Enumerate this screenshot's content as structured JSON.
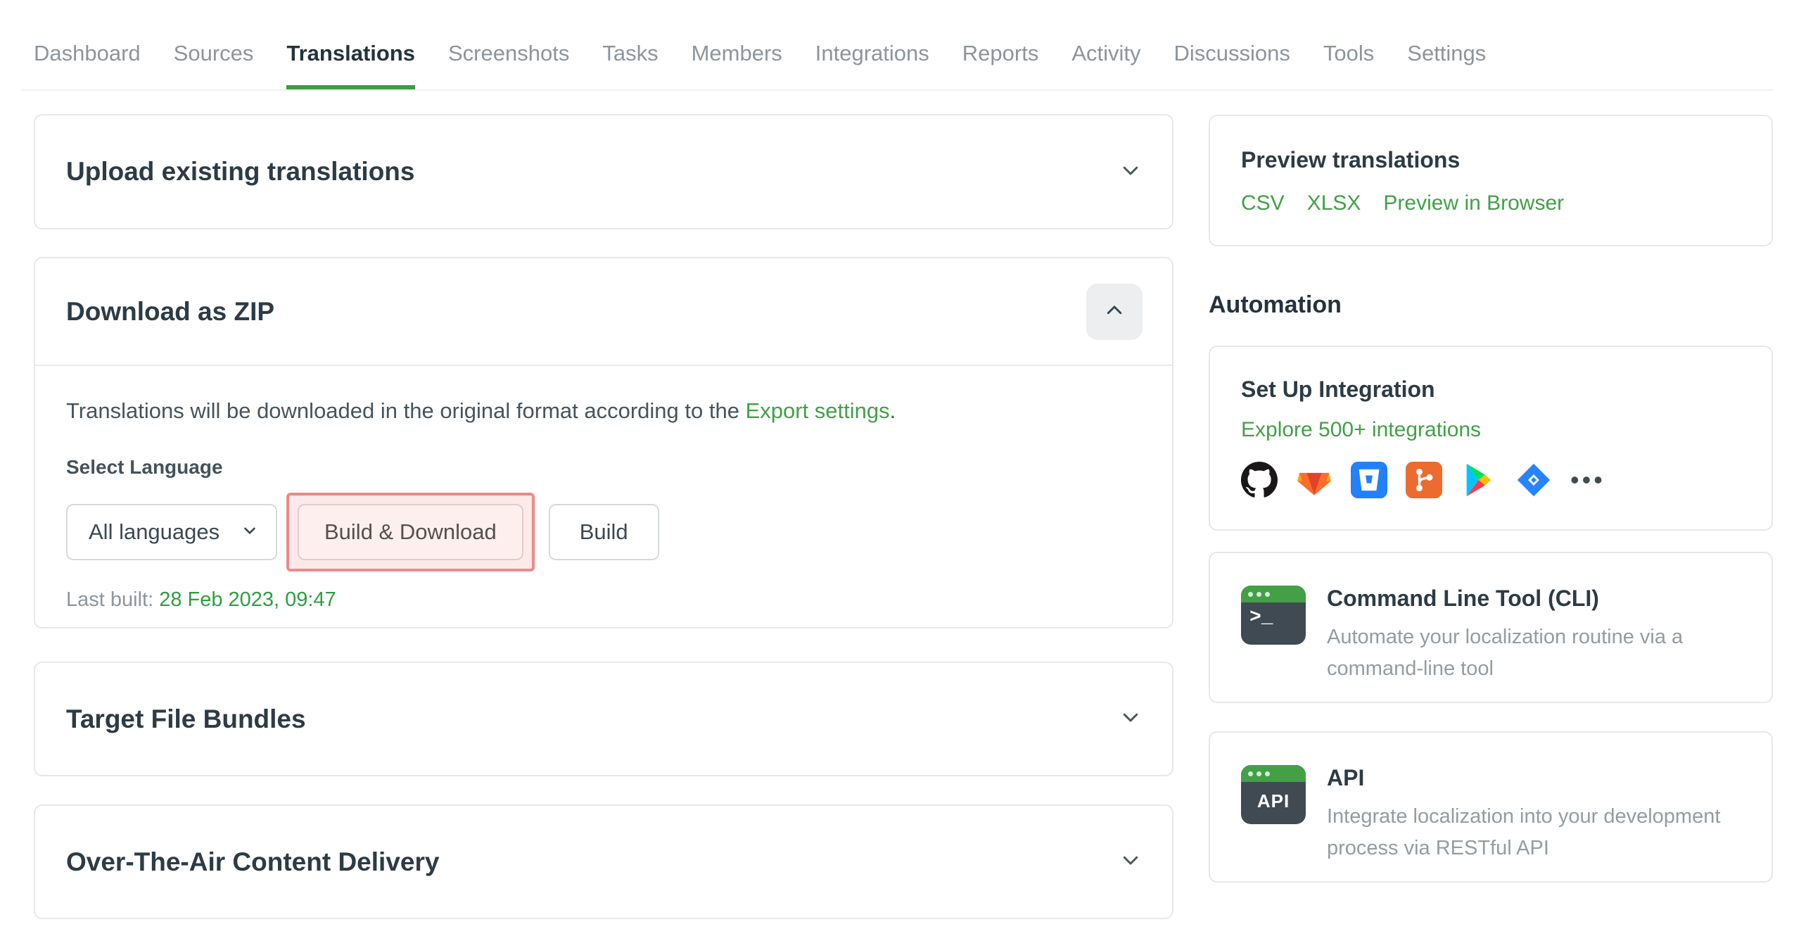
{
  "nav": {
    "tabs": [
      "Dashboard",
      "Sources",
      "Translations",
      "Screenshots",
      "Tasks",
      "Members",
      "Integrations",
      "Reports",
      "Activity",
      "Discussions",
      "Tools",
      "Settings"
    ],
    "active_tab": "Translations"
  },
  "main": {
    "upload_panel": {
      "title": "Upload existing translations"
    },
    "download_panel": {
      "title": "Download as ZIP",
      "description_prefix": "Translations will be downloaded in the original format according to the ",
      "description_link": "Export settings",
      "description_suffix": ".",
      "select_language_label": "Select Language",
      "language_select_value": "All languages",
      "build_download_label": "Build & Download",
      "build_label": "Build",
      "last_built_label": "Last built:",
      "last_built_value": "28 Feb 2023, 09:47"
    },
    "bundles_panel": {
      "title": "Target File Bundles"
    },
    "ota_panel": {
      "title": "Over-The-Air Content Delivery"
    }
  },
  "sidebar": {
    "preview": {
      "title": "Preview translations",
      "links": [
        "CSV",
        "XLSX",
        "Preview in Browser"
      ]
    },
    "automation_heading": "Automation",
    "integration": {
      "title": "Set Up Integration",
      "link": "Explore 500+ integrations",
      "icons": [
        "github",
        "gitlab",
        "bitbucket",
        "git",
        "google-play",
        "jira",
        "more"
      ],
      "more_glyph": "•••"
    },
    "cli": {
      "title": "Command Line Tool (CLI)",
      "description": "Automate your localization routine via a command-line tool",
      "icon_text": ">_"
    },
    "api": {
      "title": "API",
      "description": "Integrate localization into your development process via RESTful API",
      "icon_text": "API"
    }
  },
  "colors": {
    "accent_green": "#43a047",
    "active_tab_underline": "#3e9c46",
    "highlight_border": "#ec8a88",
    "highlight_fill": "#f8d7d6"
  }
}
